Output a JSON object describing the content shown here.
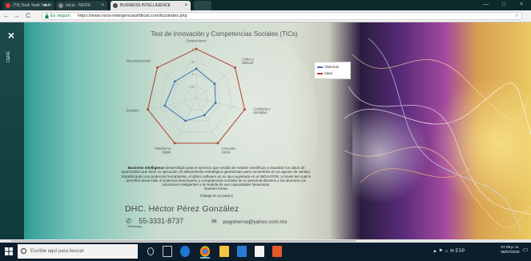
{
  "browser": {
    "tabs": [
      {
        "label": "(79) Yeah Yeah Yeah - ",
        "favicon_color": "#e53935",
        "extra": "◄ ×"
      },
      {
        "label": "Inicio - NOOS",
        "favicon_color": "#888888",
        "extra": "×"
      },
      {
        "label": "BUSINESS INTELLIGENCE",
        "favicon_color": "#4a4a4a",
        "extra": "×",
        "active": true
      }
    ],
    "window_controls": [
      "—",
      "□",
      "×"
    ],
    "nav": {
      "back": "←",
      "forward": "→",
      "reload": "C"
    },
    "address": {
      "secure_label": "Es seguro",
      "url": "https://www.noos-inteligenciaartificial.com/tics/index.php"
    }
  },
  "sidebar": {
    "close_glyph": "×",
    "label": "CERE"
  },
  "test": {
    "title": "Test de Innovación y Competencias Sociales (TICs)",
    "controls": "▯ ▯",
    "axes": [
      "Fuentes de Conocimiento",
      "Orden y Método",
      "Conducta y disciplina",
      "Conexión social",
      "Plataforma digital",
      "Solidario",
      "Neurodesarrollo"
    ],
    "tick_labels": [
      "2",
      "1.5",
      "1",
      "0.5"
    ]
  },
  "chart_data": {
    "type": "radar",
    "title": "Test de Innovación y Competencias Sociales (TICs)",
    "categories": [
      "Fuentes de Conocimiento",
      "Orden y Método",
      "Conducta y disciplina",
      "Conexión social",
      "Plataforma digital",
      "Solidario",
      "Neurodesarrollo"
    ],
    "series": [
      {
        "name": "Obtenido",
        "color": "#3b6fb6",
        "values": [
          1.2,
          0.95,
          0.8,
          0.75,
          1.0,
          1.3,
          1.1
        ]
      },
      {
        "name": "Ideal",
        "color": "#b0402e",
        "values": [
          2,
          2,
          2,
          2,
          2,
          2,
          2
        ]
      }
    ],
    "ylim": [
      0,
      2
    ],
    "grid": true,
    "legend": "top-right"
  },
  "legend": {
    "items": [
      {
        "label": "Obtenido",
        "color": "#3b6fb6"
      },
      {
        "label": "Ideal",
        "color": "#b0402e"
      }
    ]
  },
  "description": {
    "lead": "Business Intelligence",
    "body": " desarrollado para el ejercicio que resulta de realizar científicas a visualizar los datos de oportunidad que tiene su ejecución. El alineamiento estratégico garantizado para convertirlos en un agente de cambio. Estabilizando una poderosa herramienta, el último software en su tipo registrado en el INDAUTOR, a través del cual le permitirá desarrollar el potencial desempeño y competencias sociales de su personal directivo y los alumnos con soluciones inteligentes a la medida de sus capacidades financieras.",
    "tail": "Nuestro forma.",
    "invite": "Trabaje en un para ti"
  },
  "contact": {
    "name": "DHC. Héctor Pérez González",
    "phone": "55-3331-8737",
    "phone_label": "Whatsapp",
    "email": "pegoherna@yahoo.com.mx"
  },
  "taskbar": {
    "search_placeholder": "Escribe aquí para buscar",
    "tray": "▲  ⚑  ☼  ✉  ESP",
    "time": "07:29 p. m.",
    "date": "06/07/2018"
  }
}
